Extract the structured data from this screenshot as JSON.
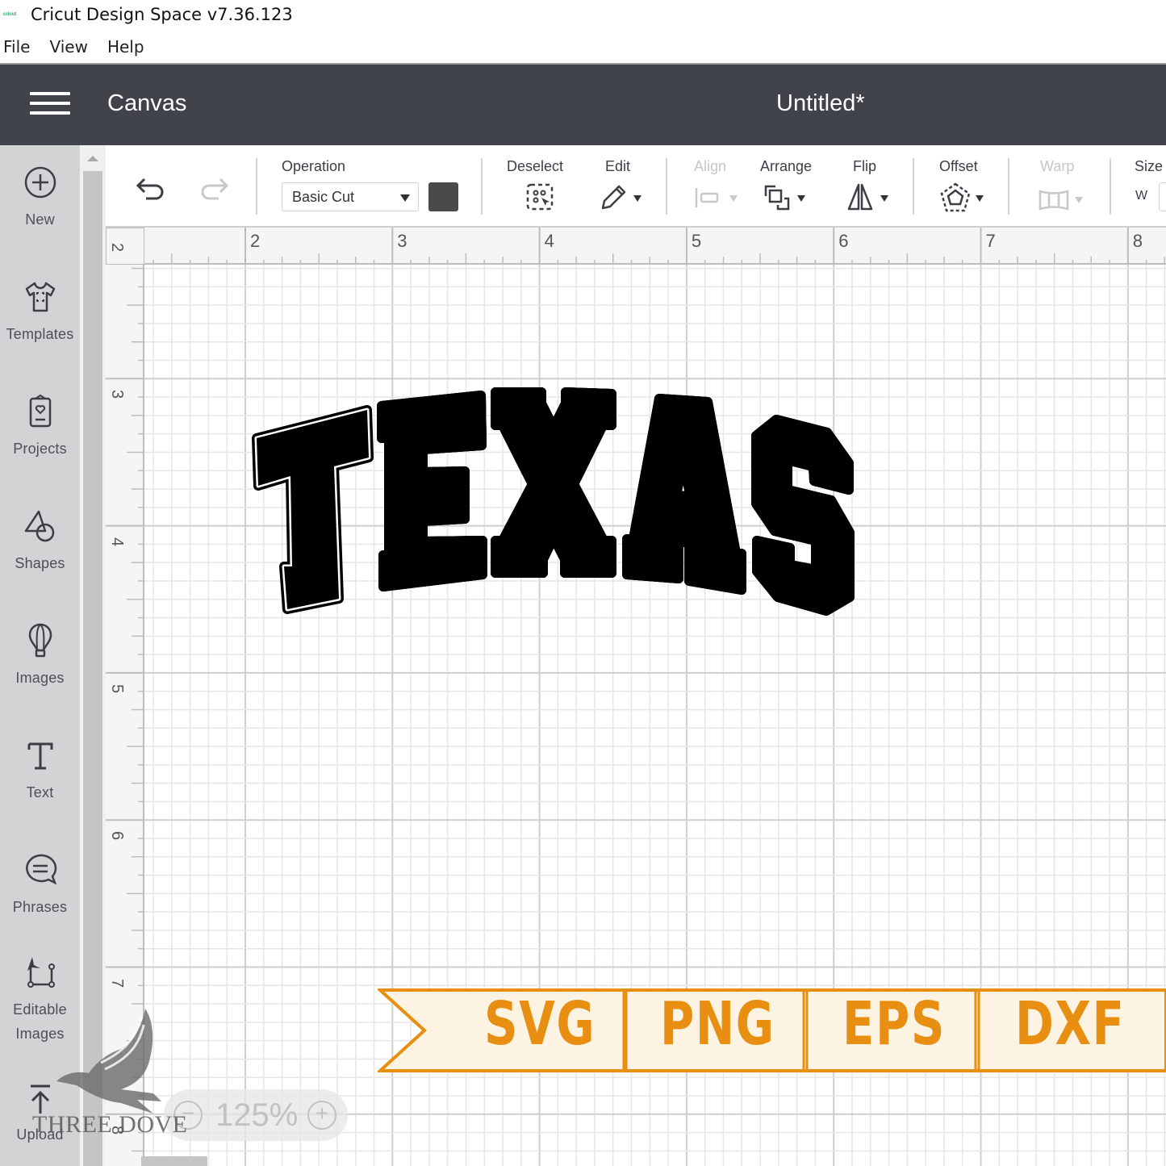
{
  "window": {
    "logo_text": "cricut",
    "title": "Cricut Design Space  v7.36.123"
  },
  "menubar": [
    "File",
    "View",
    "Help"
  ],
  "header": {
    "section": "Canvas",
    "document_title": "Untitled*"
  },
  "sidebar": {
    "items": [
      {
        "label": "New",
        "icon": "plus-circle-icon"
      },
      {
        "label": "Templates",
        "icon": "tshirt-icon"
      },
      {
        "label": "Projects",
        "icon": "card-heart-icon"
      },
      {
        "label": "Shapes",
        "icon": "shapes-icon"
      },
      {
        "label": "Images",
        "icon": "balloon-icon"
      },
      {
        "label": "Text",
        "icon": "text-t-icon"
      },
      {
        "label": "Phrases",
        "icon": "speech-bubble-icon"
      },
      {
        "label": "Editable",
        "label2": "Images",
        "icon": "node-edit-icon"
      },
      {
        "label": "Upload",
        "icon": "upload-icon"
      }
    ]
  },
  "toolbar": {
    "undo": "undo-icon",
    "redo": "redo-icon",
    "operation_label": "Operation",
    "operation_value": "Basic Cut",
    "color": "#4a4a4a",
    "deselect_label": "Deselect",
    "edit_label": "Edit",
    "align_label": "Align",
    "arrange_label": "Arrange",
    "flip_label": "Flip",
    "offset_label": "Offset",
    "warp_label": "Warp",
    "size_label": "Size",
    "size_w_label": "W"
  },
  "canvas": {
    "ruler_top_labels": [
      "2",
      "3",
      "4",
      "5",
      "6",
      "7",
      "8"
    ],
    "ruler_left_labels": [
      "2",
      "3",
      "4",
      "5",
      "6",
      "7",
      "8"
    ],
    "design_text": "TEXAS",
    "zoom_level": "125%",
    "zoom_out": "−",
    "zoom_in": "+"
  },
  "overlay": {
    "watermark": "THREE DOVE",
    "banner_color": "#e88f12",
    "banner_bg": "#fdf3e3",
    "formats": [
      "SVG",
      "PNG",
      "EPS",
      "DXF"
    ]
  }
}
